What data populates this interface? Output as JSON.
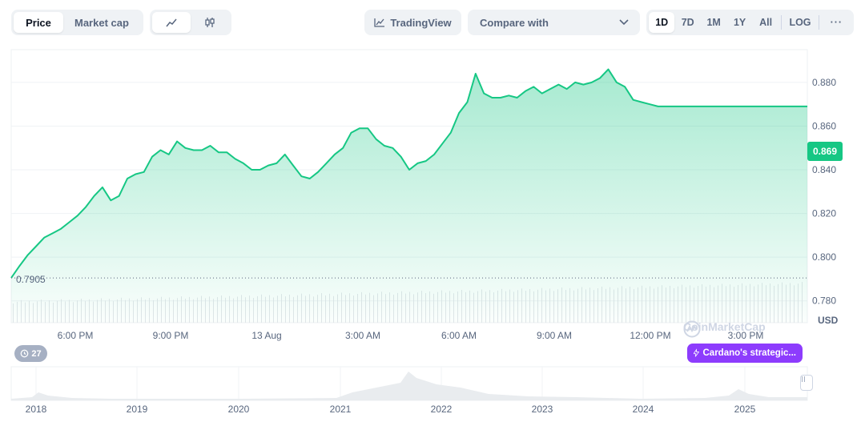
{
  "toolbar": {
    "chart_type_tabs": [
      {
        "label": "Price",
        "active": true
      },
      {
        "label": "Market cap",
        "active": false
      }
    ],
    "chart_kind": {
      "line_icon": "line-chart-icon",
      "candle_icon": "candlestick-icon",
      "active": "line"
    },
    "tradingview_label": "TradingView",
    "tradingview_icon": "tradingview-chart-icon",
    "compare_label": "Compare with",
    "compare_icon": "chevron-down-icon",
    "ranges": [
      "1D",
      "7D",
      "1M",
      "1Y",
      "All"
    ],
    "active_range": "1D",
    "log_label": "LOG",
    "more_label": "···"
  },
  "chart_data": {
    "type": "area",
    "currency": "USD",
    "unit_label": "USD",
    "accent_color": "#16c784",
    "ylim": [
      0.77,
      0.895
    ],
    "yticks": [
      "0.780",
      "0.800",
      "0.820",
      "0.840",
      "0.860",
      "0.880"
    ],
    "xticks": [
      "6:00 PM",
      "9:00 PM",
      "13 Aug",
      "3:00 AM",
      "6:00 AM",
      "9:00 AM",
      "12:00 PM",
      "3:00 PM"
    ],
    "open_price": 0.7905,
    "open_price_label": "0.7905",
    "current_price": 0.869,
    "current_price_label": "0.869",
    "grid": true,
    "series": [
      {
        "x": [
          0.0,
          0.25,
          0.5,
          0.75,
          1.0,
          1.25,
          1.5,
          1.75,
          2.0,
          2.25,
          2.5,
          2.75,
          3.0,
          3.25,
          3.5,
          3.75,
          4.0,
          4.25,
          4.5,
          4.75,
          5.0,
          5.25,
          5.5,
          5.75,
          6.0,
          6.25,
          6.5,
          6.75,
          7.0,
          7.25,
          7.5,
          7.75,
          8.0,
          8.25,
          8.5,
          8.75,
          9.0,
          9.25,
          9.5,
          9.75,
          10.0,
          10.25,
          10.5,
          10.75,
          11.0,
          11.25,
          11.5,
          11.75,
          12.0,
          12.25,
          12.5,
          12.75,
          13.0,
          13.25,
          13.5,
          13.75,
          14.0,
          14.25,
          14.5,
          14.75,
          15.0,
          15.25,
          15.5,
          15.75,
          16.0,
          16.25,
          16.5,
          16.75,
          17.0,
          17.25,
          17.5,
          17.75,
          18.0,
          18.25,
          18.5,
          18.75,
          19.0,
          19.25,
          19.5,
          19.75,
          20.0,
          20.25,
          20.5,
          20.75,
          21.0,
          21.25,
          21.5,
          21.75,
          22.0,
          22.25,
          22.5,
          22.75,
          23.0,
          23.25,
          23.5,
          23.75,
          24.0
        ],
        "values": [
          0.7905,
          0.796,
          0.801,
          0.805,
          0.809,
          0.811,
          0.813,
          0.816,
          0.819,
          0.823,
          0.828,
          0.832,
          0.826,
          0.828,
          0.836,
          0.838,
          0.839,
          0.846,
          0.849,
          0.847,
          0.853,
          0.85,
          0.849,
          0.849,
          0.851,
          0.848,
          0.848,
          0.845,
          0.843,
          0.84,
          0.84,
          0.842,
          0.843,
          0.847,
          0.842,
          0.837,
          0.836,
          0.839,
          0.843,
          0.847,
          0.85,
          0.857,
          0.859,
          0.859,
          0.854,
          0.851,
          0.85,
          0.846,
          0.84,
          0.843,
          0.844,
          0.847,
          0.852,
          0.857,
          0.866,
          0.871,
          0.884,
          0.875,
          0.873,
          0.873,
          0.874,
          0.873,
          0.876,
          0.878,
          0.875,
          0.877,
          0.879,
          0.877,
          0.88,
          0.879,
          0.88,
          0.882,
          0.886,
          0.88,
          0.878,
          0.872,
          0.871,
          0.87,
          0.869,
          0.869,
          0.869,
          0.869,
          0.869,
          0.869,
          0.869,
          0.869,
          0.869,
          0.869,
          0.869,
          0.869,
          0.869,
          0.869,
          0.869,
          0.869,
          0.869,
          0.869,
          0.869
        ]
      }
    ],
    "volume_bars": true,
    "watermark": "CoinMarketCap"
  },
  "events": {
    "badge_icon": "history-clock-icon",
    "count": "27"
  },
  "news": {
    "icon": "lightning-icon",
    "label": "Cardano's strategic..."
  },
  "navigator": {
    "years": [
      "2018",
      "2019",
      "2020",
      "2021",
      "2022",
      "2023",
      "2024",
      "2025"
    ],
    "handle_icon": "drag-handle-icon"
  }
}
